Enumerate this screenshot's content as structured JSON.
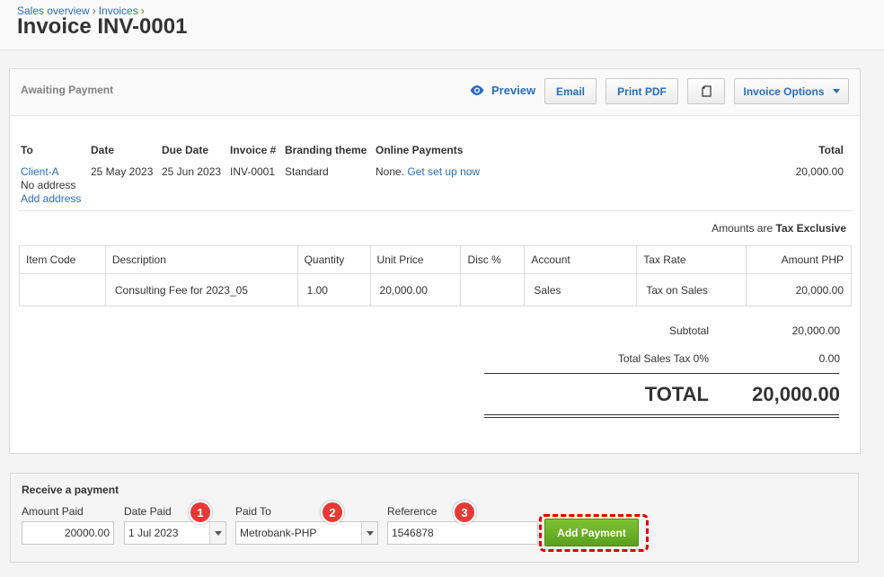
{
  "breadcrumb": {
    "sales_overview": "Sales overview",
    "invoices": "Invoices",
    "sep": "›"
  },
  "page_title": "Invoice INV-0001",
  "status": "Awaiting Payment",
  "toolbar": {
    "preview": "Preview",
    "email": "Email",
    "print_pdf": "Print PDF",
    "invoice_options": "Invoice Options"
  },
  "info": {
    "to_label": "To",
    "to_value": "Client-A",
    "no_address": "No address",
    "add_address": "Add address",
    "date_label": "Date",
    "date_value": "25 May 2023",
    "due_label": "Due Date",
    "due_value": "25 Jun 2023",
    "invoice_no_label": "Invoice #",
    "invoice_no_value": "INV-0001",
    "branding_label": "Branding theme",
    "branding_value": "Standard",
    "online_label": "Online Payments",
    "online_value": "None.",
    "online_link": "Get set up now",
    "total_label": "Total",
    "total_value": "20,000.00"
  },
  "amounts_are": {
    "prefix": "Amounts are",
    "value": "Tax Exclusive"
  },
  "table": {
    "headers": [
      "Item Code",
      "Description",
      "Quantity",
      "Unit Price",
      "Disc %",
      "Account",
      "Tax Rate",
      "Amount PHP"
    ],
    "rows": [
      {
        "item_code": "",
        "description": "Consulting Fee for 2023_05",
        "quantity": "1.00",
        "unit_price": "20,000.00",
        "disc": "",
        "account": "Sales",
        "tax_rate": "Tax on Sales",
        "amount": "20,000.00"
      }
    ]
  },
  "totals": {
    "subtotal_label": "Subtotal",
    "subtotal_value": "20,000.00",
    "tax_label": "Total Sales Tax 0%",
    "tax_value": "0.00",
    "total_label": "TOTAL",
    "total_value": "20,000.00"
  },
  "payment": {
    "title": "Receive a payment",
    "amount_label": "Amount Paid",
    "amount_value": "20000.00",
    "date_label": "Date Paid",
    "date_value": "1 Jul 2023",
    "paid_to_label": "Paid To",
    "paid_to_value": "Metrobank-PHP",
    "reference_label": "Reference",
    "reference_value": "1546878",
    "add_button": "Add Payment",
    "badges": [
      "1",
      "2",
      "3"
    ]
  },
  "colors": {
    "link": "#2a6ebb",
    "add_button": "#6db22a",
    "badge": "#e53935",
    "highlight": "#e00000"
  }
}
